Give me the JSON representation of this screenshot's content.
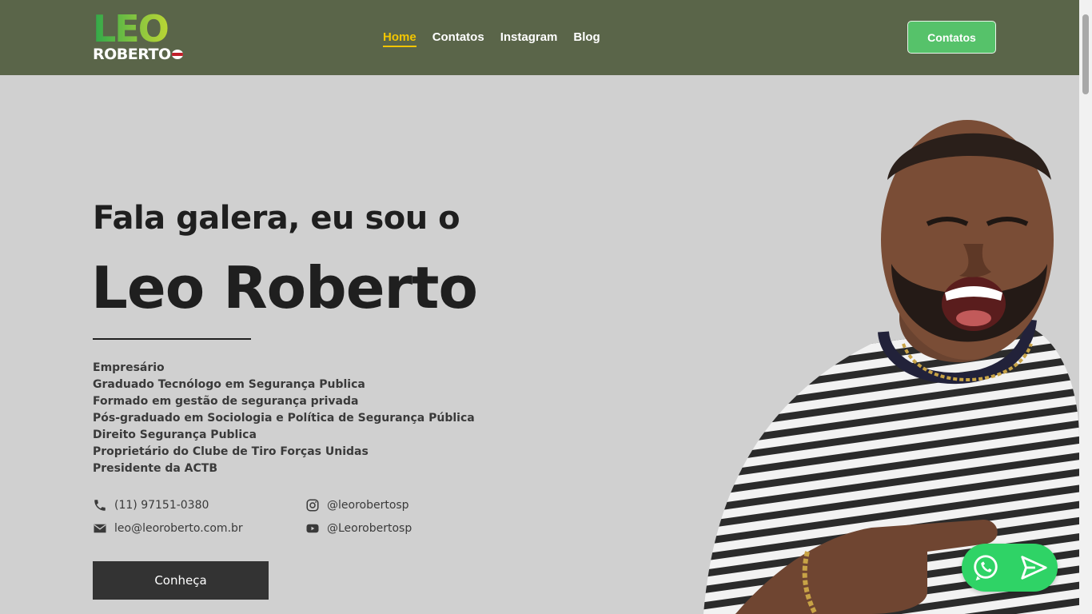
{
  "logo": {
    "top": "LEO",
    "bottom": "ROBERTO"
  },
  "nav": [
    {
      "label": "Home",
      "active": true
    },
    {
      "label": "Contatos",
      "active": false
    },
    {
      "label": "Instagram",
      "active": false
    },
    {
      "label": "Blog",
      "active": false
    }
  ],
  "header_cta": "Contatos",
  "hero": {
    "greeting": "Fala galera, eu sou o",
    "name": "Leo Roberto",
    "bio": [
      "Empresário",
      "Graduado Tecnólogo em Segurança Publica",
      "Formado em gestão de segurança privada",
      "Pós-graduado em Sociologia e Política de Segurança Pública",
      "Direito Segurança Publica",
      "Proprietário do Clube de Tiro Forças Unidas",
      "Presidente da ACTB"
    ],
    "contacts": {
      "phone": "(11) 97151-0380",
      "email": "leo@leoroberto.com.br",
      "instagram": "@leorobertosp",
      "youtube": "@Leorobertosp"
    },
    "button": "Conheça"
  },
  "colors": {
    "header_bg": "#5a6549",
    "page_bg": "#d0d0d0",
    "accent_yellow": "#f2c500",
    "cta_green": "#56c26a",
    "whatsapp_green": "#2fd366"
  }
}
